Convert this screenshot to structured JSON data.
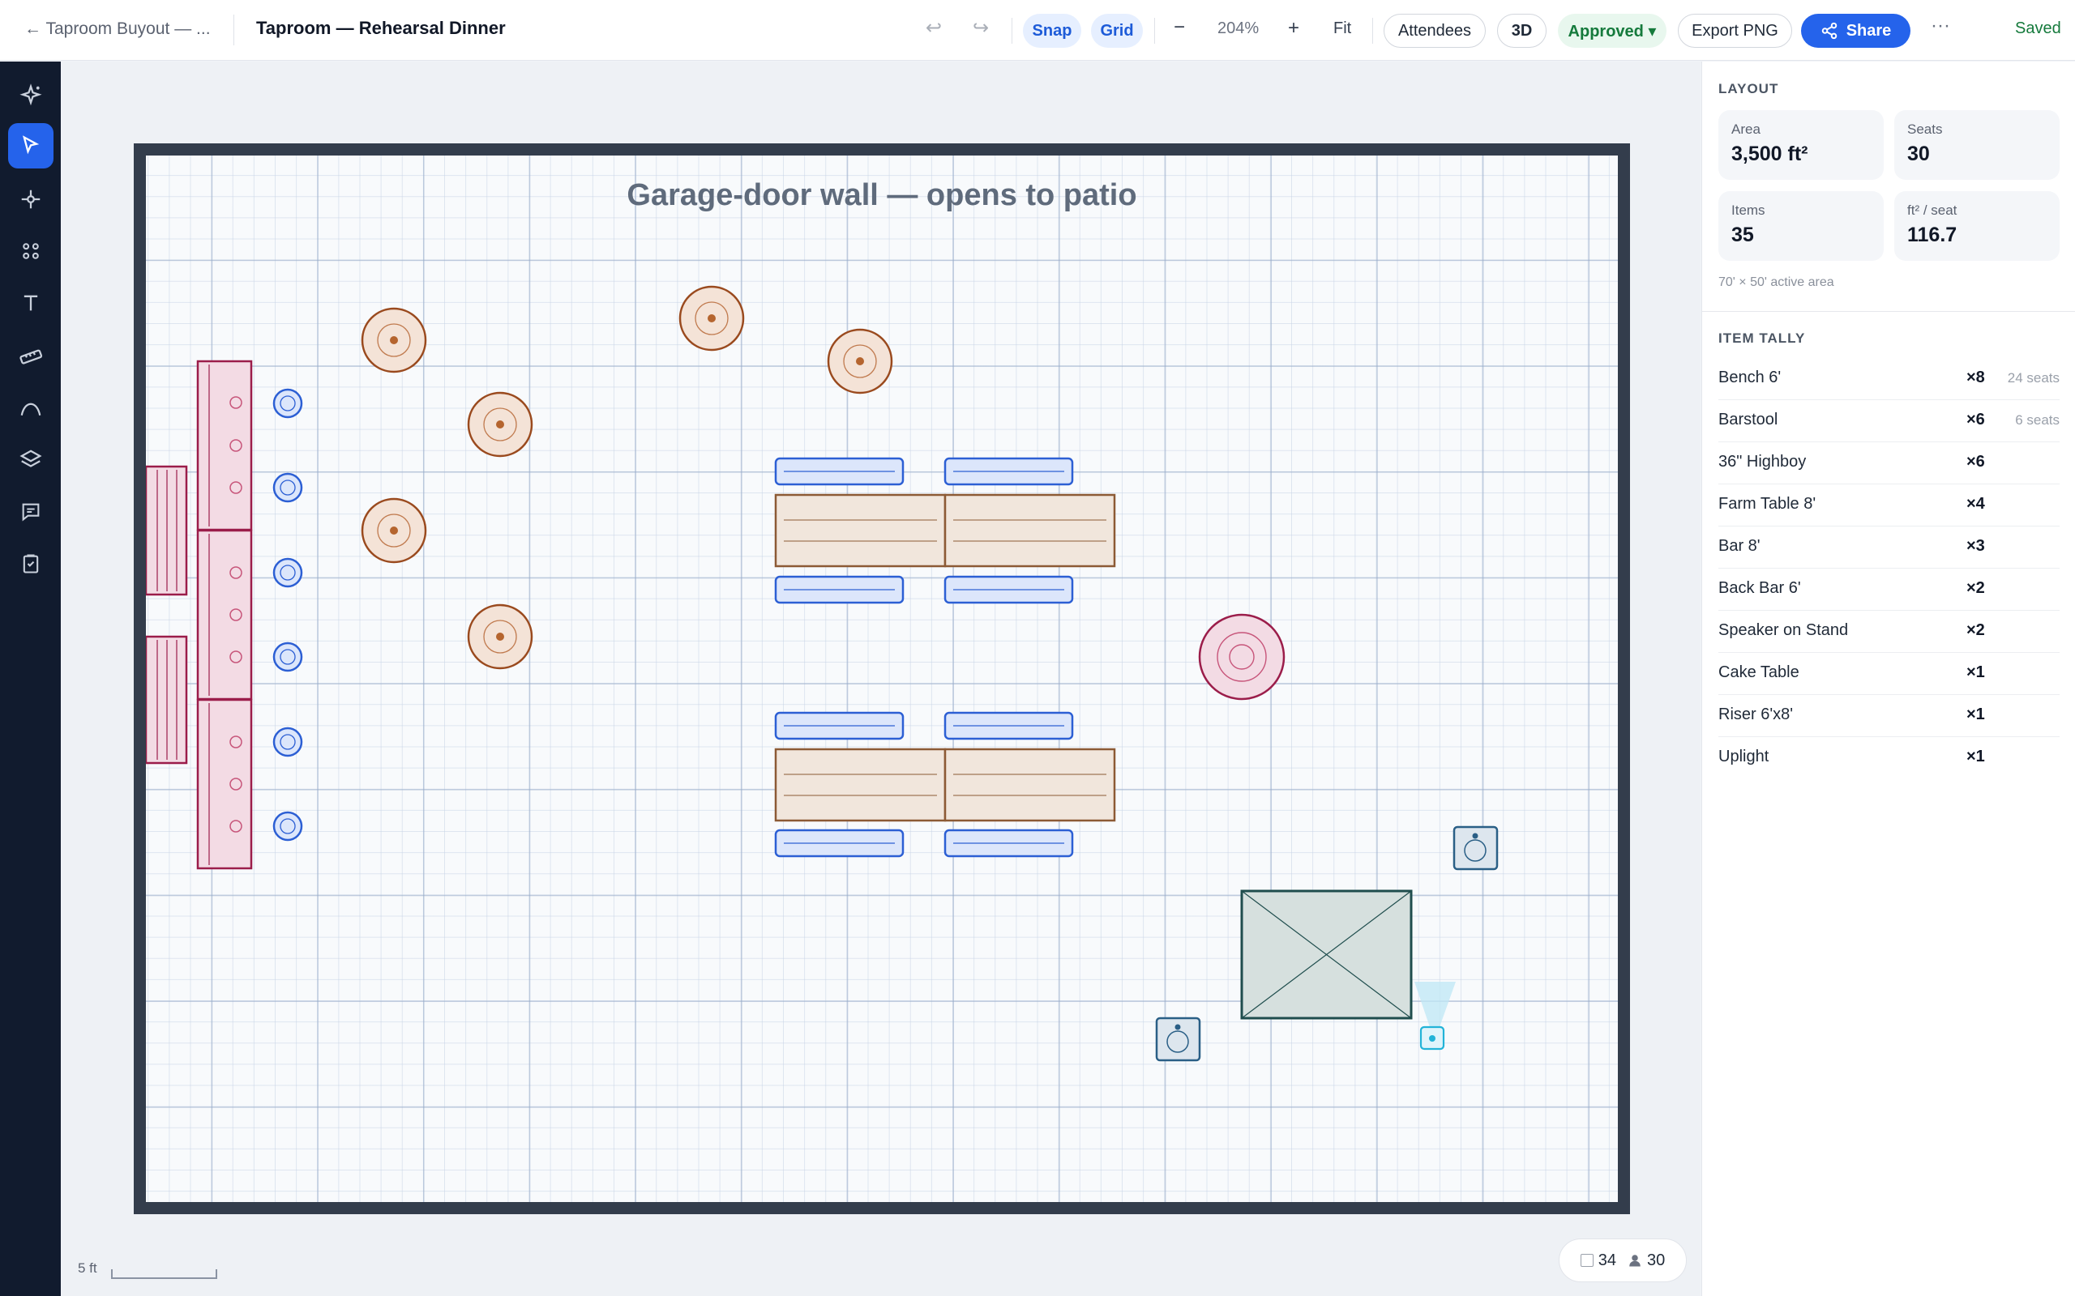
{
  "topbar": {
    "back_label": "← Taproom Buyout — ...",
    "title": "Taproom — Rehearsal Dinner",
    "snap_label": "Snap",
    "grid_label": "Grid",
    "zoom_out_label": "−",
    "zoom_level": "204%",
    "zoom_in_label": "+",
    "fit_label": "Fit",
    "attendees_label": "Attendees",
    "view3d_label": "3D",
    "status_label": "Approved ▾",
    "export_label": "Export PNG",
    "share_label": "Share",
    "more_label": "···",
    "saved_label": "Saved"
  },
  "rail": {
    "icons": [
      "sparkle-icon",
      "pointer-icon",
      "nodes-icon",
      "grid-dots-icon",
      "text-icon",
      "ruler-icon",
      "curve-icon",
      "layers-icon",
      "comment-icon",
      "checklist-icon"
    ]
  },
  "canvas": {
    "wall_label": "Garage-door wall — opens to patio",
    "scale_label": "5 ft"
  },
  "status_counter": {
    "items": "34",
    "people": "30"
  },
  "panel": {
    "layout_title": "LAYOUT",
    "stats": [
      {
        "label": "Area",
        "value": "3,500 ft²"
      },
      {
        "label": "Seats",
        "value": "30"
      },
      {
        "label": "Items",
        "value": "35"
      },
      {
        "label": "ft² / seat",
        "value": "116.7"
      }
    ],
    "active_area": "70' × 50' active area",
    "tally_title": "ITEM TALLY",
    "tally": [
      {
        "name": "Bench 6'",
        "count": "×8",
        "seats": "24 seats"
      },
      {
        "name": "Barstool",
        "count": "×6",
        "seats": "6 seats"
      },
      {
        "name": "36\" Highboy",
        "count": "×6",
        "seats": ""
      },
      {
        "name": "Farm Table 8'",
        "count": "×4",
        "seats": ""
      },
      {
        "name": "Bar 8'",
        "count": "×3",
        "seats": ""
      },
      {
        "name": "Back Bar 6'",
        "count": "×2",
        "seats": ""
      },
      {
        "name": "Speaker on Stand",
        "count": "×2",
        "seats": ""
      },
      {
        "name": "Cake Table",
        "count": "×1",
        "seats": ""
      },
      {
        "name": "Riser 6'x8'",
        "count": "×1",
        "seats": ""
      },
      {
        "name": "Uplight",
        "count": "×1",
        "seats": ""
      }
    ]
  },
  "colors": {
    "accent": "#2563eb",
    "bar": "#9b1d4a",
    "bar_fill": "#f3dbe4",
    "highboy": "#9a4a1e",
    "highboy_fill": "#f4e3d7",
    "bench": "#2c5fd4",
    "bench_fill": "#dce6fb",
    "riser": "#1f4d4d",
    "riser_fill": "#d6e0de",
    "uplight": "#22b3d8",
    "speaker": "#2a5f86",
    "approved": "#157a3c"
  }
}
